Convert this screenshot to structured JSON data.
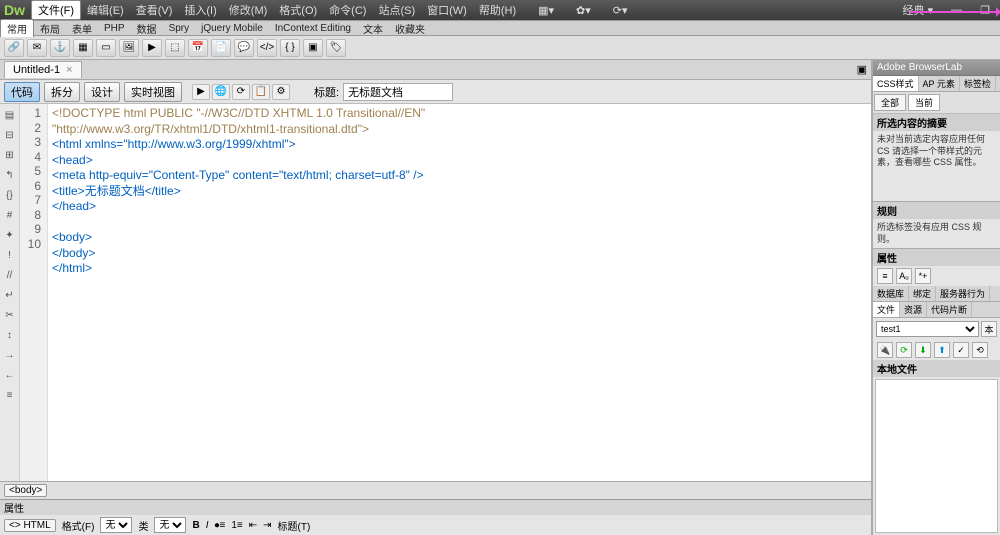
{
  "menubar": {
    "logo": "Dw",
    "items": [
      "文件(F)",
      "编辑(E)",
      "查看(V)",
      "插入(I)",
      "修改(M)",
      "格式(O)",
      "命令(C)",
      "站点(S)",
      "窗口(W)",
      "帮助(H)"
    ],
    "layout_label": "经典 ▾"
  },
  "category_tabs": [
    "常用",
    "布局",
    "表单",
    "PHP",
    "数据",
    "Spry",
    "jQuery Mobile",
    "InContext Editing",
    "文本",
    "收藏夹"
  ],
  "document": {
    "tab_title": "Untitled-1",
    "view_buttons": [
      "代码",
      "拆分",
      "设计",
      "实时视图"
    ],
    "title_label": "标题:",
    "title_value": "无标题文档"
  },
  "code_lines": [
    "<!DOCTYPE html PUBLIC \"-//W3C//DTD XHTML 1.0 Transitional//EN\"",
    "\"http://www.w3.org/TR/xhtml1/DTD/xhtml1-transitional.dtd\">",
    "<html xmlns=\"http://www.w3.org/1999/xhtml\">",
    "<head>",
    "<meta http-equiv=\"Content-Type\" content=\"text/html; charset=utf-8\" />",
    "<title>无标题文档</title>",
    "</head>",
    "",
    "<body>",
    "</body>",
    "</html>"
  ],
  "line_numbers": [
    "1",
    "2",
    "3",
    "4",
    "5",
    "6",
    "7",
    "8",
    "9",
    "10"
  ],
  "status": {
    "path_tag": "<body>"
  },
  "properties": {
    "header": "属性",
    "html_tag": "<> HTML",
    "format_label": "格式(F)",
    "format_value": "无",
    "class_label": "类",
    "class_value": "无",
    "title_prop_label": "标题(T)"
  },
  "right": {
    "browserlab": "Adobe BrowserLab",
    "css_tabs": [
      "CSS样式",
      "AP 元素",
      "标签检"
    ],
    "css_subtabs": [
      "全部",
      "当前"
    ],
    "css_summary_hdr": "所选内容的摘要",
    "css_summary_body": "未对当前选定内容应用任何 CS 请选择一个带样式的元素，查看哪些 CSS 属性。",
    "rules_hdr": "规则",
    "rules_body": "所选标签没有应用 CSS 规则。",
    "props_hdr": "属性",
    "panel_tabs2": [
      "数据库",
      "绑定",
      "服务器行为"
    ],
    "panel_tabs3": [
      "文件",
      "资源",
      "代码片断"
    ],
    "site_name": "test1",
    "site_btn": "本",
    "local_files_hdr": "本地文件"
  }
}
